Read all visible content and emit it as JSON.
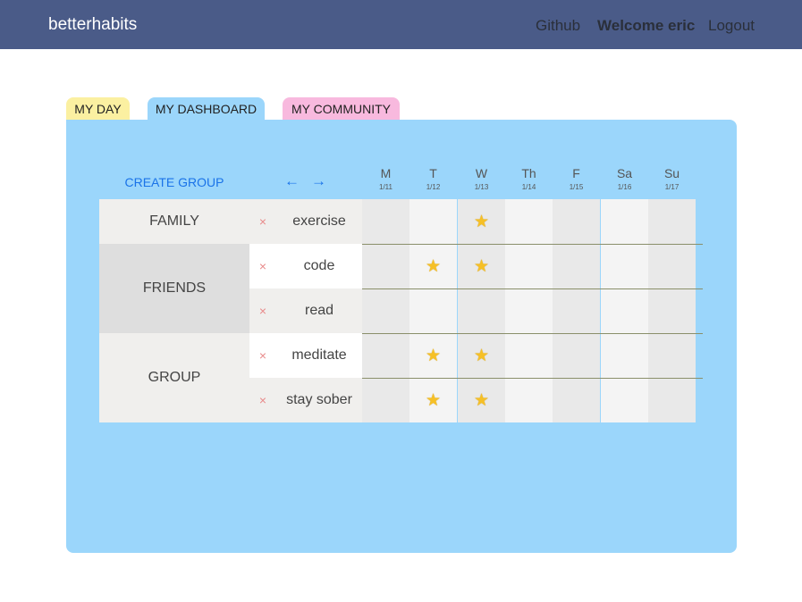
{
  "navbar": {
    "brand": "betterhabits",
    "links": {
      "github": "Github",
      "welcome": "Welcome eric",
      "logout": "Logout"
    }
  },
  "tabs": [
    {
      "label": "MY DAY",
      "color": "#fbf0a1"
    },
    {
      "label": "MY DASHBOARD",
      "color": "#9bd6fb",
      "active": true
    },
    {
      "label": "MY COMMUNITY",
      "color": "#f8b9de"
    }
  ],
  "dashboard": {
    "create_group_label": "CREATE GROUP",
    "prev_arrow": "←",
    "next_arrow": "→",
    "days": [
      {
        "name": "M",
        "date": "1/11"
      },
      {
        "name": "T",
        "date": "1/12"
      },
      {
        "name": "W",
        "date": "1/13"
      },
      {
        "name": "Th",
        "date": "1/14"
      },
      {
        "name": "F",
        "date": "1/15"
      },
      {
        "name": "Sa",
        "date": "1/16"
      },
      {
        "name": "Su",
        "date": "1/17"
      }
    ],
    "delete_symbol": "×",
    "star_symbol": "★",
    "groups": [
      {
        "name": "FAMILY",
        "habits": [
          {
            "name": "exercise",
            "done": [
              false,
              false,
              true,
              false,
              false,
              false,
              false
            ]
          }
        ]
      },
      {
        "name": "FRIENDS",
        "habits": [
          {
            "name": "code",
            "done": [
              false,
              true,
              true,
              false,
              false,
              false,
              false
            ]
          },
          {
            "name": "read",
            "done": [
              false,
              false,
              false,
              false,
              false,
              false,
              false
            ]
          }
        ]
      },
      {
        "name": "GROUP",
        "habits": [
          {
            "name": "meditate",
            "done": [
              false,
              true,
              true,
              false,
              false,
              false,
              false
            ]
          },
          {
            "name": "stay sober",
            "done": [
              false,
              true,
              true,
              false,
              false,
              false,
              false
            ]
          }
        ]
      }
    ]
  }
}
